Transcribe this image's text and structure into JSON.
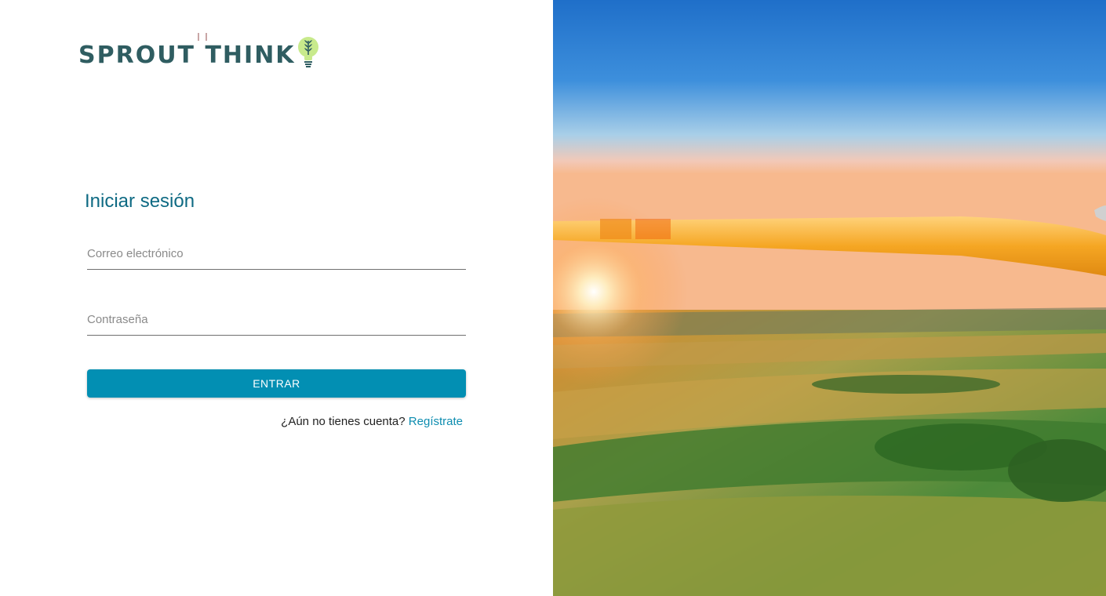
{
  "brand": {
    "name": "SPROUT THINK",
    "logo_color": "#2f5d61",
    "bulb_color": "#b9e07a"
  },
  "login": {
    "title": "Iniciar sesión",
    "email_placeholder": "Correo electrónico",
    "email_value": "",
    "password_placeholder": "Contraseña",
    "password_value": "",
    "submit_label": "ENTRAR",
    "signup_prompt": "¿Aún no tienes cuenta?",
    "signup_link": "Regístrate",
    "accent_color": "#028fb3"
  },
  "hero": {
    "image": "hero-landscape-image",
    "description_icon": "drone-propeller-over-fields"
  }
}
